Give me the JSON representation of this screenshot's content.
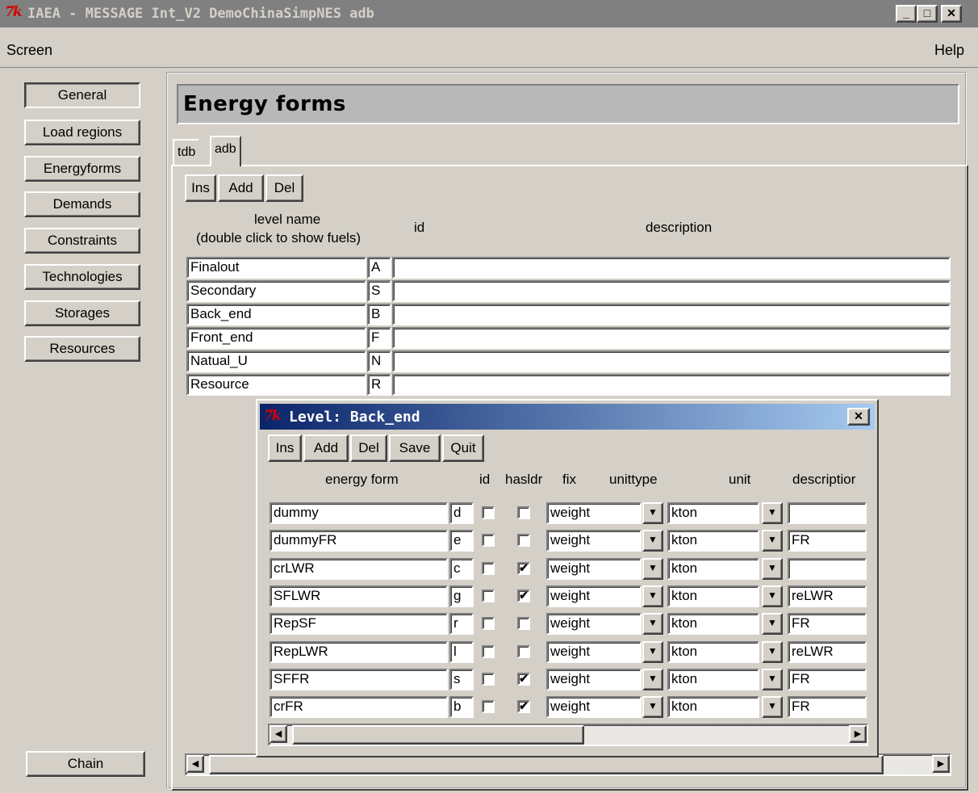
{
  "window": {
    "icon_text": "7k",
    "title": "IAEA - MESSAGE Int_V2 DemoChinaSimpNES adb",
    "controls": {
      "minimize": "_",
      "maximize": "□",
      "close": "✕"
    }
  },
  "menubar": {
    "screen": "Screen",
    "help": "Help"
  },
  "nav": {
    "items": [
      "General",
      "Load regions",
      "Energyforms",
      "Demands",
      "Constraints",
      "Technologies",
      "Storages",
      "Resources"
    ],
    "chain": "Chain"
  },
  "main": {
    "header": "Energy forms",
    "tabs": [
      "tdb",
      "adb"
    ],
    "buttons": {
      "ins": "Ins",
      "add": "Add",
      "del": "Del"
    },
    "columns": {
      "level_name_line1": "level name",
      "level_name_line2": "(double click to show fuels)",
      "id": "id",
      "description": "description"
    },
    "levels": [
      {
        "name": "Finalout",
        "id": "A",
        "description": ""
      },
      {
        "name": "Secondary",
        "id": "S",
        "description": ""
      },
      {
        "name": "Back_end",
        "id": "B",
        "description": ""
      },
      {
        "name": "Front_end",
        "id": "F",
        "description": ""
      },
      {
        "name": "Natual_U",
        "id": "N",
        "description": ""
      },
      {
        "name": "Resource",
        "id": "R",
        "description": ""
      }
    ]
  },
  "dialog": {
    "icon_text": "7k",
    "title": "Level: Back_end",
    "close": "✕",
    "buttons": {
      "ins": "Ins",
      "add": "Add",
      "del": "Del",
      "save": "Save",
      "quit": "Quit"
    },
    "columns": {
      "energy_form": "energy form",
      "id": "id",
      "hasldr": "hasldr",
      "fix": "fix",
      "unittype": "unittype",
      "unit": "unit",
      "description": "descriptior"
    },
    "rows": [
      {
        "energy_form": "dummy",
        "id": "d",
        "fix": false,
        "hasldr": false,
        "unittype": "weight",
        "unit": "kton",
        "description": ""
      },
      {
        "energy_form": "dummyFR",
        "id": "e",
        "fix": false,
        "hasldr": false,
        "unittype": "weight",
        "unit": "kton",
        "description": "FR"
      },
      {
        "energy_form": "crLWR",
        "id": "c",
        "fix": false,
        "hasldr": true,
        "unittype": "weight",
        "unit": "kton",
        "description": ""
      },
      {
        "energy_form": "SFLWR",
        "id": "g",
        "fix": false,
        "hasldr": true,
        "unittype": "weight",
        "unit": "kton",
        "description": "reLWR"
      },
      {
        "energy_form": "RepSF",
        "id": "r",
        "fix": false,
        "hasldr": false,
        "unittype": "weight",
        "unit": "kton",
        "description": "FR"
      },
      {
        "energy_form": "RepLWR",
        "id": "l",
        "fix": false,
        "hasldr": false,
        "unittype": "weight",
        "unit": "kton",
        "description": "reLWR"
      },
      {
        "energy_form": "SFFR",
        "id": "s",
        "fix": false,
        "hasldr": true,
        "unittype": "weight",
        "unit": "kton",
        "description": "FR"
      },
      {
        "energy_form": "crFR",
        "id": "b",
        "fix": false,
        "hasldr": true,
        "unittype": "weight",
        "unit": "kton",
        "description": "FR"
      }
    ]
  },
  "icons": {
    "checkmark": "✔",
    "dropdown": "▼",
    "scroll_left": "◀",
    "scroll_right": "▶"
  }
}
